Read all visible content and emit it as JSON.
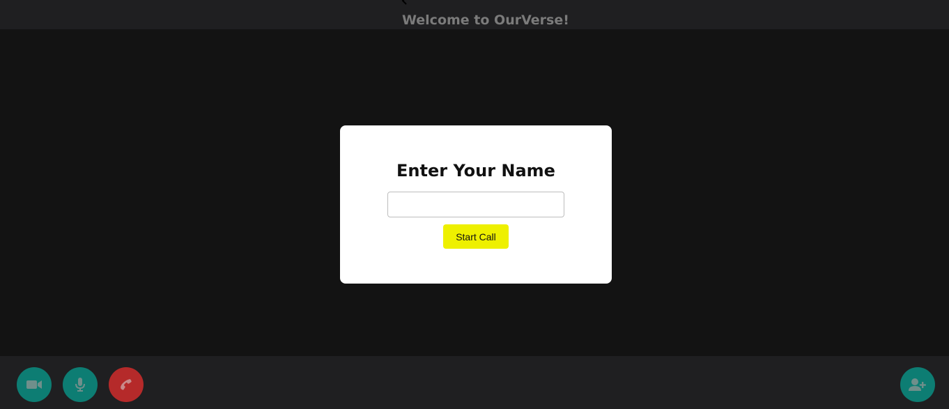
{
  "header": {
    "back_icon": "chevron-left-icon",
    "title": "Welcome to OurVerse!"
  },
  "dialog": {
    "title": "Enter Your Name",
    "name_input": {
      "value": "",
      "placeholder": ""
    },
    "start_button_label": "Start Call"
  },
  "controls": {
    "video_icon": "video-camera-icon",
    "mic_icon": "microphone-icon",
    "hangup_icon": "phone-icon",
    "invite_icon": "add-user-icon"
  },
  "colors": {
    "background": "#131313",
    "bar": "#1f1f21",
    "teal": "#0d7d73",
    "red": "#b52a2a",
    "accent_yellow": "#eef000"
  }
}
